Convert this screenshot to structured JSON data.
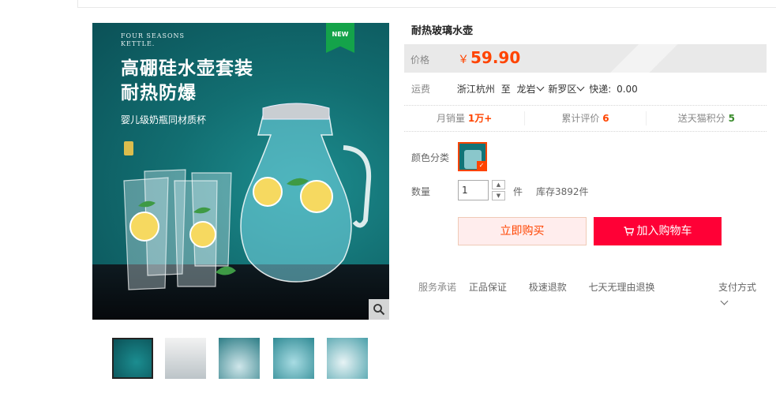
{
  "product": {
    "title": "耐热玻璃水壶",
    "image": {
      "brand_line1": "FOUR SEASONS",
      "brand_line2": "KETTLE.",
      "headline_line1": "高硼硅水壶套装",
      "headline_line2": "耐热防爆",
      "subline": "婴儿级奶瓶同材质杯",
      "new_tag": "NEW"
    },
    "thumbnails": 5
  },
  "price": {
    "label": "价格",
    "currency": "￥",
    "value": "59.90"
  },
  "shipping": {
    "label": "运费",
    "from": "浙江杭州",
    "to_word": "至",
    "city": "龙岩",
    "district": "新罗区",
    "fee_label": "快递:",
    "fee": "0.00"
  },
  "stats": {
    "monthly_sales_label": "月销量",
    "monthly_sales": "1万+",
    "reviews_label": "累计评价",
    "reviews": "6",
    "points_label": "送天猫积分",
    "points": "5"
  },
  "options": {
    "color_label": "颜色分类",
    "quantity_label": "数量",
    "quantity_value": "1",
    "unit": "件",
    "stock": "库存3892件"
  },
  "actions": {
    "buy_now": "立即购买",
    "add_to_cart": "加入购物车"
  },
  "service": {
    "label": "服务承诺",
    "items": [
      "正品保证",
      "极速退款",
      "七天无理由退换"
    ],
    "payment": "支付方式"
  },
  "colors": {
    "price_red": "#ff4400",
    "cart_red": "#ff0036",
    "points_green": "#3a8c2c"
  }
}
